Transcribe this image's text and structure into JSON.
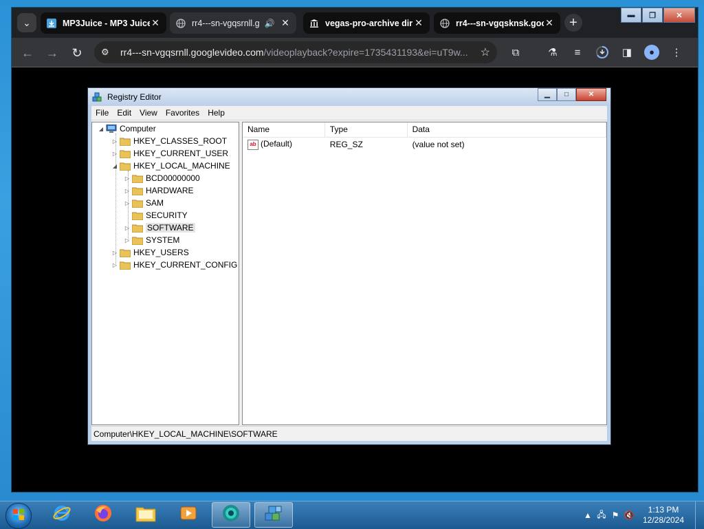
{
  "browser": {
    "tabs": [
      {
        "title": "MP3Juice - MP3 Juice",
        "close": "✕"
      },
      {
        "title": "rr4---sn-vgqsrnll.g",
        "audio": "🔊",
        "close": "✕"
      },
      {
        "title": "vegas-pro-archive dir",
        "close": "✕"
      },
      {
        "title": "rr4---sn-vgqsknsk.goo",
        "close": "✕"
      }
    ],
    "new_tab_label": "+",
    "url_host": "rr4---sn-vgqsrnll.googlevideo.com",
    "url_path": "/videoplayback?expire=1735431193&ei=uT9w...",
    "window_controls": {
      "minimize": "▬",
      "maximize": "❐",
      "close": "✕"
    }
  },
  "regedit": {
    "title": "Registry Editor",
    "menu": [
      "File",
      "Edit",
      "View",
      "Favorites",
      "Help"
    ],
    "tree": [
      {
        "label": "Computer",
        "level": 0,
        "expander": "◢"
      },
      {
        "label": "HKEY_CLASSES_ROOT",
        "level": 1,
        "expander": "▷"
      },
      {
        "label": "HKEY_CURRENT_USER",
        "level": 1,
        "expander": "▷"
      },
      {
        "label": "HKEY_LOCAL_MACHINE",
        "level": 1,
        "expander": "◢"
      },
      {
        "label": "BCD00000000",
        "level": 2,
        "expander": "▷"
      },
      {
        "label": "HARDWARE",
        "level": 2,
        "expander": "▷"
      },
      {
        "label": "SAM",
        "level": 2,
        "expander": "▷"
      },
      {
        "label": "SECURITY",
        "level": 2,
        "expander": ""
      },
      {
        "label": "SOFTWARE",
        "level": 2,
        "expander": "▷",
        "selected": true
      },
      {
        "label": "SYSTEM",
        "level": 2,
        "expander": "▷"
      },
      {
        "label": "HKEY_USERS",
        "level": 1,
        "expander": "▷"
      },
      {
        "label": "HKEY_CURRENT_CONFIG",
        "level": 1,
        "expander": "▷"
      }
    ],
    "columns": {
      "name": "Name",
      "type": "Type",
      "data": "Data"
    },
    "values": [
      {
        "icon": "ab",
        "name": "(Default)",
        "type": "REG_SZ",
        "data": "(value not set)"
      }
    ],
    "status_path": "Computer\\HKEY_LOCAL_MACHINE\\SOFTWARE"
  },
  "taskbar": {
    "time": "1:13 PM",
    "date": "12/28/2024"
  }
}
